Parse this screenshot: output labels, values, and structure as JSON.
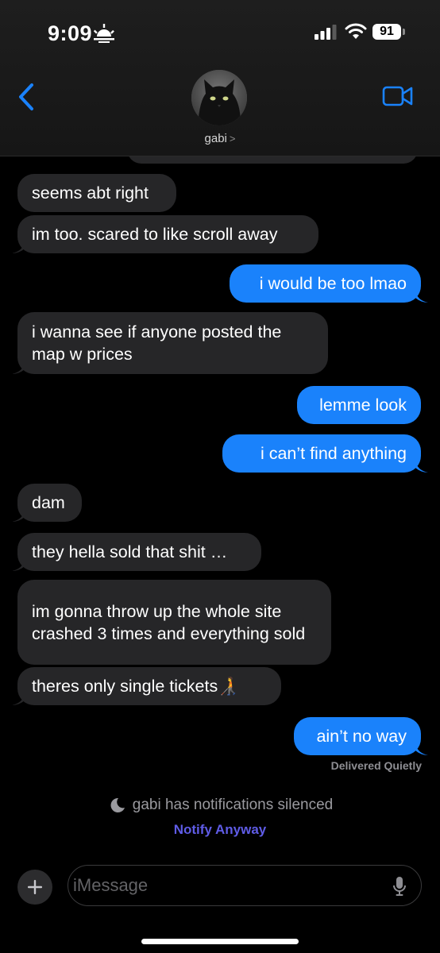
{
  "status_bar": {
    "time": "9:09",
    "battery": "91"
  },
  "header": {
    "contact_name": "gabi",
    "contact_chevron": ">"
  },
  "messages": [
    {
      "dir": "in",
      "text": "seems abt right"
    },
    {
      "dir": "in",
      "text": "im too. scared to like scroll away"
    },
    {
      "dir": "out",
      "text": "i would be too lmao"
    },
    {
      "dir": "in",
      "text": "i wanna see if anyone posted the map w prices"
    },
    {
      "dir": "out",
      "text": "lemme look"
    },
    {
      "dir": "out",
      "text": "i can’t find anything"
    },
    {
      "dir": "in",
      "text": "dam"
    },
    {
      "dir": "in",
      "text": "they hella sold that shit …"
    },
    {
      "dir": "in",
      "text": "im gonna throw up the whole site crashed 3 times and everything sold"
    },
    {
      "dir": "in",
      "text": "theres only single tickets🧑‍🦯"
    },
    {
      "dir": "out",
      "text": "ain’t no way"
    }
  ],
  "delivered_status": "Delivered Quietly",
  "silenced_notice": "gabi has notifications silenced",
  "notify_anyway": "Notify Anyway",
  "composer": {
    "placeholder": "iMessage"
  },
  "icons": {
    "sun": "sunrise-icon",
    "signal": "signal-icon",
    "wifi": "wifi-icon",
    "back": "back-chevron-icon",
    "video": "video-camera-icon",
    "moon": "moon-icon",
    "plus": "plus-icon",
    "mic": "microphone-icon"
  },
  "colors": {
    "incoming_bubble": "#262628",
    "outgoing_bubble": "#1a82fb",
    "notify_link": "#5f5ce6"
  }
}
